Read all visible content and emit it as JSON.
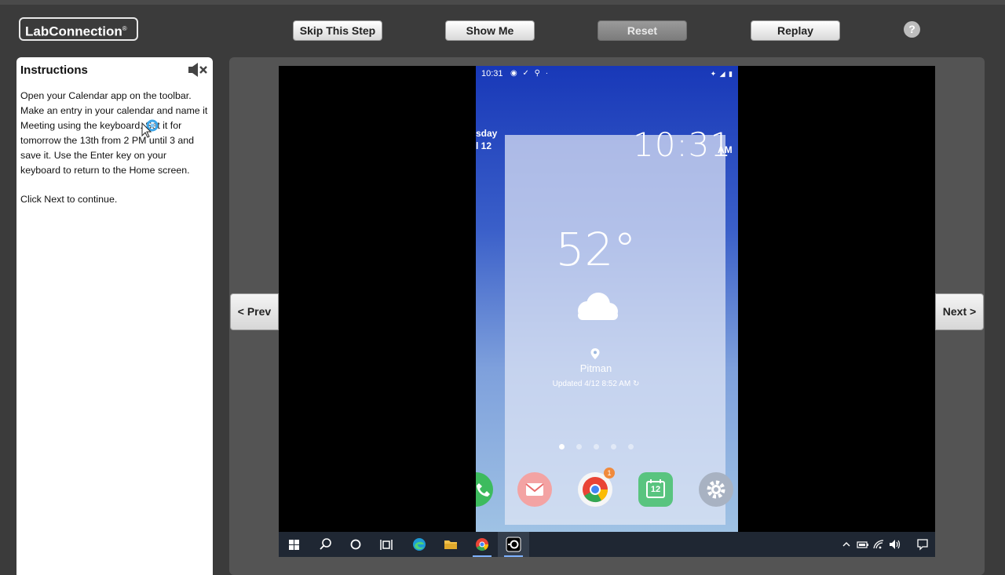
{
  "brand": {
    "name": "LabConnection",
    "mark": "®"
  },
  "toolbar": {
    "skip": "Skip This Step",
    "show": "Show Me",
    "reset": "Reset",
    "replay": "Replay",
    "help": "?"
  },
  "instructions": {
    "title": "Instructions",
    "mute_icon": "speaker-mute-icon",
    "body": "Open your Calendar app on the toolbar. Make an entry in your calendar and name it Meeting using the keyboard. Set it for tomorrow the 13th from 2 PM until 3 and save it. Use the Enter key on your keyboard to return to the Home screen.",
    "continue": "Click Next to continue."
  },
  "nav": {
    "prev": "< Prev",
    "next": "Next >"
  },
  "phone": {
    "status_time": "10:31",
    "date_line1": "sday",
    "date_line2": "l 12",
    "clock": "10:31",
    "ampm": "AM",
    "temperature": "52°",
    "weather_icon": "cloud-icon",
    "location": "Pitman",
    "updated": "Updated 4/12 8:52 AM",
    "page_dots": 5,
    "active_dot": 0,
    "dock": [
      {
        "name": "phone-app-icon",
        "color": "#3dbb5e"
      },
      {
        "name": "email-app-icon",
        "color": "#e96b6b"
      },
      {
        "name": "chrome-app-icon",
        "color": "#ffffff",
        "badge": "1"
      },
      {
        "name": "calendar-app-icon",
        "color": "#4fbf7a",
        "label": "12"
      },
      {
        "name": "settings-app-icon",
        "color": "#8e98a8"
      }
    ]
  },
  "taskbar": {
    "items": [
      "start-icon",
      "search-icon",
      "cortana-icon",
      "task-view-icon",
      "edge-icon",
      "file-explorer-icon",
      "chrome-icon",
      "app-active-icon"
    ],
    "tray": [
      "chevron-up-icon",
      "battery-icon",
      "wifi-icon",
      "volume-icon",
      "notification-icon"
    ]
  },
  "colors": {
    "background": "#3b3b3b",
    "stage": "#545454",
    "phone_top": "#1838b8",
    "phone_bottom": "#9fc2e4",
    "taskbar": "#1f2733"
  }
}
